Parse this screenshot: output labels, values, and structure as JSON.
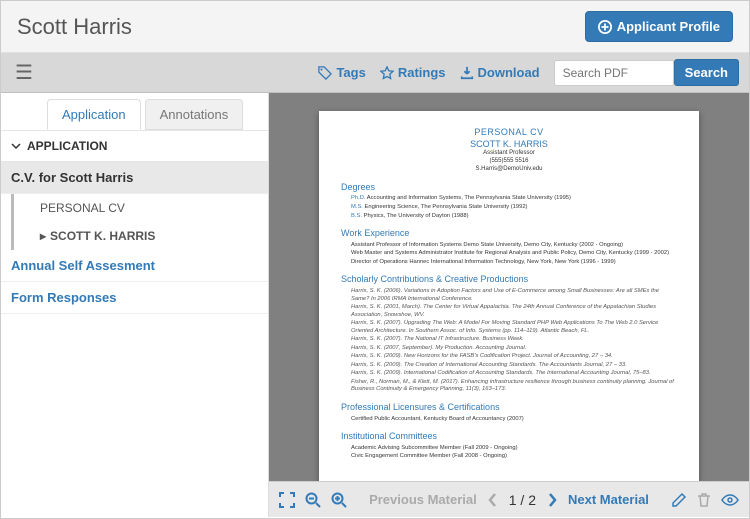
{
  "header": {
    "title": "Scott Harris",
    "profile_btn": "Applicant Profile"
  },
  "toolbar": {
    "tags": "Tags",
    "ratings": "Ratings",
    "download": "Download",
    "search_placeholder": "Search PDF",
    "search_btn": "Search"
  },
  "sidebar": {
    "tabs": {
      "application": "Application",
      "annotations": "Annotations"
    },
    "section_label": "APPLICATION",
    "item_cv": "C.V. for Scott Harris",
    "sub_personal": "PERSONAL CV",
    "sub_name": "SCOTT K. HARRIS",
    "item_self": "Annual Self Assesment",
    "item_forms": "Form Responses"
  },
  "doc": {
    "heading": "PERSONAL CV",
    "name": "SCOTT K. HARRIS",
    "role": "Assistant Professor",
    "phone": "(555)555 5516",
    "email": "S.Harris@DemoUniv.edu",
    "sections": {
      "degrees": {
        "title": "Degrees",
        "items": [
          {
            "deg": "Ph.D.",
            "rest": " Accounting and Information Systems, The Pennsylvania State University (1995)"
          },
          {
            "deg": "M.S.",
            "rest": " Engineering Science, The Pennsylvania State University (1992)"
          },
          {
            "deg": "B.S.",
            "rest": " Physics, The University of Dayton (1988)"
          }
        ]
      },
      "work": {
        "title": "Work Experience",
        "items": [
          "Assistant Professor of Information Systems Demo State University, Demo City, Kentucky (2002 - Ongoing)",
          "Web Master and Systems Administrator Institute for Regional Analysis and Public Policy, Demo City, Kentucky (1999 - 2002)",
          "Director of Operations Hannec International Information Technology, New York, New York (1996 - 1999)"
        ]
      },
      "scholarly": {
        "title": "Scholarly Contributions & Creative Productions",
        "items": [
          "Harris, S. K. (2006). Variations in Adoption Factors and Use of E-Commerce among Small Businesses: Are all SMEs the Same? In 2006 IRMA International Conference.",
          "Harris, S. K. (2001, March). The Center for Virtual Appalachia. The 24th Annual Conference of the Appalachian Studies Association, Snowshoe, WV.",
          "Harris, S. K. (2007). Upgrading The Web: A Model For Moving Standard PHP Web Applications To The Web 2.0 Service Oriented Architecture. In Southern Assoc. of Info. Systems (pp. 114–119). Atlantic Beach, FL.",
          "Harris, S. K. (2007). The National IT Infrastructure. Business Week.",
          "Harris, S. K. (2007, September). My Production. Accounting Journal.",
          "Harris, S. K. (2009). New Horizons for the FASB's Codification Project. Journal of Accounting, 27 – 34.",
          "Harris, S. K. (2009). The Creation of International Accounting Standards. The Accountants Journal, 27 – 33.",
          "Harris, S. K. (2009). International Codification of Accounting Standards. The International Accounting Journal, 75–83.",
          "Fisher, R., Norman, M., & Klett, M. (2017). Enhancing infrastructure resilience through business continuity planning. Journal of Business Continuity & Emergency Planning, 11(3), 163–173."
        ]
      },
      "licenses": {
        "title": "Professional Licensures & Certifications",
        "items": [
          "Certified Public Accountant, Kentucky Board of Accountancy (2007)"
        ]
      },
      "committees": {
        "title": "Institutional Committees",
        "items": [
          "Academic Advising Subcommittee Member (Fall 2009 - Ongoing)",
          "Civic Engagement Committee Member (Fall 2008 - Ongoing)"
        ]
      }
    }
  },
  "footer": {
    "prev": "Previous Material",
    "next": "Next Material",
    "page_cur": "1",
    "page_sep": " / ",
    "page_total": "2"
  }
}
